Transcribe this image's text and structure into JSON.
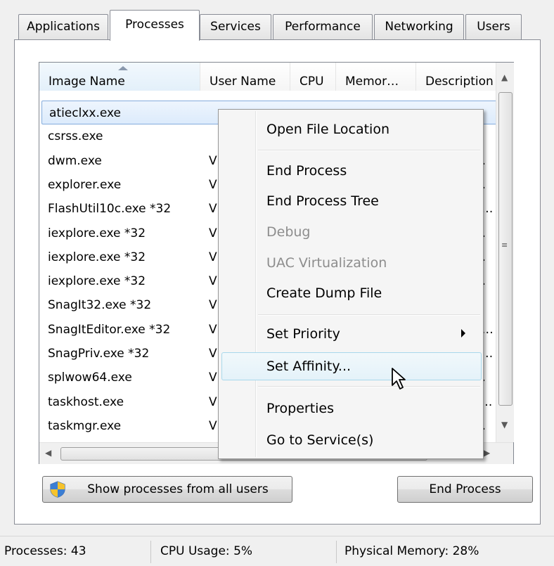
{
  "tabs": [
    {
      "label": "Applications",
      "active": false
    },
    {
      "label": "Processes",
      "active": true
    },
    {
      "label": "Services",
      "active": false
    },
    {
      "label": "Performance",
      "active": false
    },
    {
      "label": "Networking",
      "active": false
    },
    {
      "label": "Users",
      "active": false
    }
  ],
  "columns": [
    "Image Name",
    "User Name",
    "CPU",
    "Memor…",
    "Description"
  ],
  "rows": [
    {
      "name": "atieclxx.exe",
      "user": "",
      "desc": ""
    },
    {
      "name": "csrss.exe",
      "user": "",
      "desc": ""
    },
    {
      "name": "dwm.exe",
      "user": "V",
      "desc": "…"
    },
    {
      "name": "explorer.exe",
      "user": "V",
      "desc": "…"
    },
    {
      "name": "FlashUtil10c.exe *32",
      "user": "V",
      "desc": "a…"
    },
    {
      "name": "iexplore.exe *32",
      "user": "V",
      "desc": "…"
    },
    {
      "name": "iexplore.exe *32",
      "user": "V",
      "desc": "…"
    },
    {
      "name": "iexplore.exe *32",
      "user": "V",
      "desc": "…"
    },
    {
      "name": "SnagIt32.exe *32",
      "user": "V",
      "desc": ""
    },
    {
      "name": "SnagItEditor.exe *32",
      "user": "V",
      "desc": "d…"
    },
    {
      "name": "SnagPriv.exe *32",
      "user": "V",
      "desc": "P…"
    },
    {
      "name": "splwow64.exe",
      "user": "V",
      "desc": "…"
    },
    {
      "name": "taskhost.exe",
      "user": "V",
      "desc": "c…"
    },
    {
      "name": "taskmgr.exe",
      "user": "V",
      "desc": "…"
    }
  ],
  "context_menu": {
    "items": [
      {
        "label": "Open File Location",
        "enabled": true
      },
      {
        "label": "End Process",
        "enabled": true
      },
      {
        "label": "End Process Tree",
        "enabled": true
      },
      {
        "label": "Debug",
        "enabled": false
      },
      {
        "label": "UAC Virtualization",
        "enabled": false
      },
      {
        "label": "Create Dump File",
        "enabled": true
      },
      {
        "label": "Set Priority",
        "enabled": true,
        "submenu": true
      },
      {
        "label": "Set Affinity...",
        "enabled": true,
        "highlighted": true
      },
      {
        "label": "Properties",
        "enabled": true
      },
      {
        "label": "Go to Service(s)",
        "enabled": true
      }
    ]
  },
  "buttons": {
    "show_all_users": "Show processes from all users",
    "end_process": "End Process"
  },
  "status": {
    "processes": "Processes: 43",
    "cpu": "CPU Usage: 5%",
    "memory": "Physical Memory: 28%"
  },
  "icons": {
    "shield": "uac-shield-icon",
    "cursor": "mouse-pointer-icon"
  },
  "colors": {
    "selection_border": "#84acdd",
    "menu_highlight": "#a8d8eb"
  }
}
